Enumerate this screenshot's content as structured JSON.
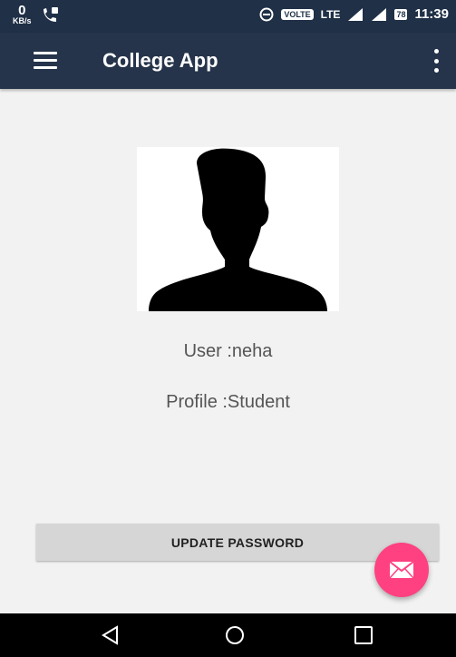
{
  "status": {
    "net_speed": "0",
    "net_unit": "KB/s",
    "volte": "VOLTE",
    "lte": "LTE",
    "battery": "78",
    "time": "11:39"
  },
  "appbar": {
    "title": "College App"
  },
  "profile": {
    "user_text": "User :neha",
    "profile_text": "Profile :Student"
  },
  "actions": {
    "update_password": "UPDATE PASSWORD"
  },
  "colors": {
    "appbar": "#25344a",
    "fab": "#ff4081",
    "background": "#f2f2f2"
  }
}
